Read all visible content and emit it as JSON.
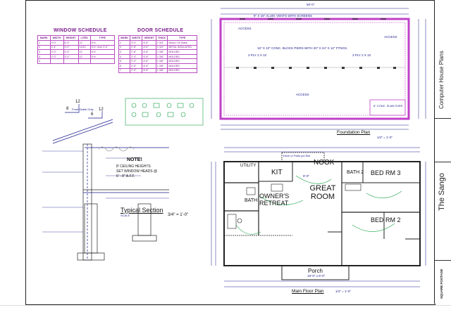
{
  "window_schedule": {
    "title": "WINDOW SCHEDULE",
    "headers": [
      "MARK",
      "WIDTH",
      "HEIGHT",
      "LITES",
      "TYPE"
    ],
    "rows": [
      [
        "1",
        "3'-0\"",
        "6'-0\"",
        "12",
        "S.H."
      ],
      [
        "2",
        "2'-4\"",
        "3'-0\"",
        "12/12",
        "S.H. Over 3'-0\""
      ],
      [
        "3",
        "2'-0\"",
        "3'-0\"",
        "12",
        "S.H."
      ],
      [
        "4",
        "2'-0\"",
        "3'-0\"",
        "12",
        "S.H."
      ],
      [
        "5",
        "",
        "",
        "",
        ""
      ]
    ]
  },
  "door_schedule": {
    "title": "DOOR SCHEDULE",
    "headers": [
      "MARK",
      "WIDTH",
      "HEIGHT",
      "THICK",
      "TYPE"
    ],
    "rows": [
      [
        "1",
        "3'-0\"",
        "6'-8\"",
        "1 3/4\"",
        "Wood / 15 Glass"
      ],
      [
        "2",
        "2'-8\"",
        "6'-8\"",
        "1 3/4\"",
        "METAL INSULATED"
      ],
      [
        "3",
        "2'-6\"",
        "6'-8\"",
        "1 3/8\"",
        "MOLDED"
      ],
      [
        "4",
        "2'-4\"",
        "6'-8\"",
        "1 3/8\"",
        "MOLDED"
      ],
      [
        "5",
        "2'-0\"",
        "6'-8\"",
        "1 3/8\"",
        "MOLDED"
      ],
      [
        "6",
        "2'-6\"",
        "6'-8\"",
        "1 3/8\"",
        "MOLDED"
      ],
      [
        "7",
        "2'-0\"",
        "6'-8\"",
        "1 3/8\"",
        "MOLDED"
      ]
    ]
  },
  "foundation": {
    "vents_note": "8\" X 16\" ALUM. VENTS WITH SCREENS",
    "access_top": "ACCESS",
    "access_right": "ACCESS",
    "access_bottom": "ACCESS",
    "footing_note": "16\" X 10\" CONC. BLOCK PIERS WITH 20\" X 24\" X 12\" FTNGS.",
    "beam_left": "3 PLY 2 X 10",
    "beam_right": "3 PLY 2 X 10",
    "slab_note": "6\" CONC. SLAB OVER",
    "title": "Foundation Plan",
    "scale": "1/4\" = 1'-0\"",
    "width_dim": "50'-0\""
  },
  "section": {
    "title": "Typical Section",
    "scale_label": "SCALE",
    "scale": "3/4\" = 1'-0\"",
    "pitch_run": "12",
    "pitch_rise": "8",
    "pitch_run2": "12",
    "pitch_rise2": "6",
    "gable_note": "Front Gable Only",
    "note_title": "NOTE!",
    "note_lines": [
      "8' CEILING HEIGHTS",
      "SET WINDOW HEADS @",
      "6' - 8\" A.F.F."
    ]
  },
  "floor_plan": {
    "rooms": {
      "utility": "UTILITY",
      "kit": "KIT",
      "nook": "NOOK",
      "bath2": "BATH 2",
      "bed3": "BED RM 3",
      "bath": "BATH",
      "great_room": "GREAT ROOM",
      "owners_retreat": "OWNER'S RETREAT",
      "bed2": "BED RM 2",
      "porch": "Porch",
      "porch_dim": "18'-0\" x 6'-0\"",
      "deck": "Deck or Patio per Bid"
    },
    "ceiling_note": "9'-0\"",
    "title": "Main Floor Plan",
    "scale": "1/4\" = 1'-0\""
  },
  "title_block": {
    "company": "Computer House Plans",
    "plan_name": "The Sango",
    "square_footage": "SQUARE FOOTAGE"
  },
  "colors": {
    "ink": "#1a1a8c",
    "wall": "#c040c8",
    "schedule": "#7a1a8c",
    "red": "#d01818"
  }
}
